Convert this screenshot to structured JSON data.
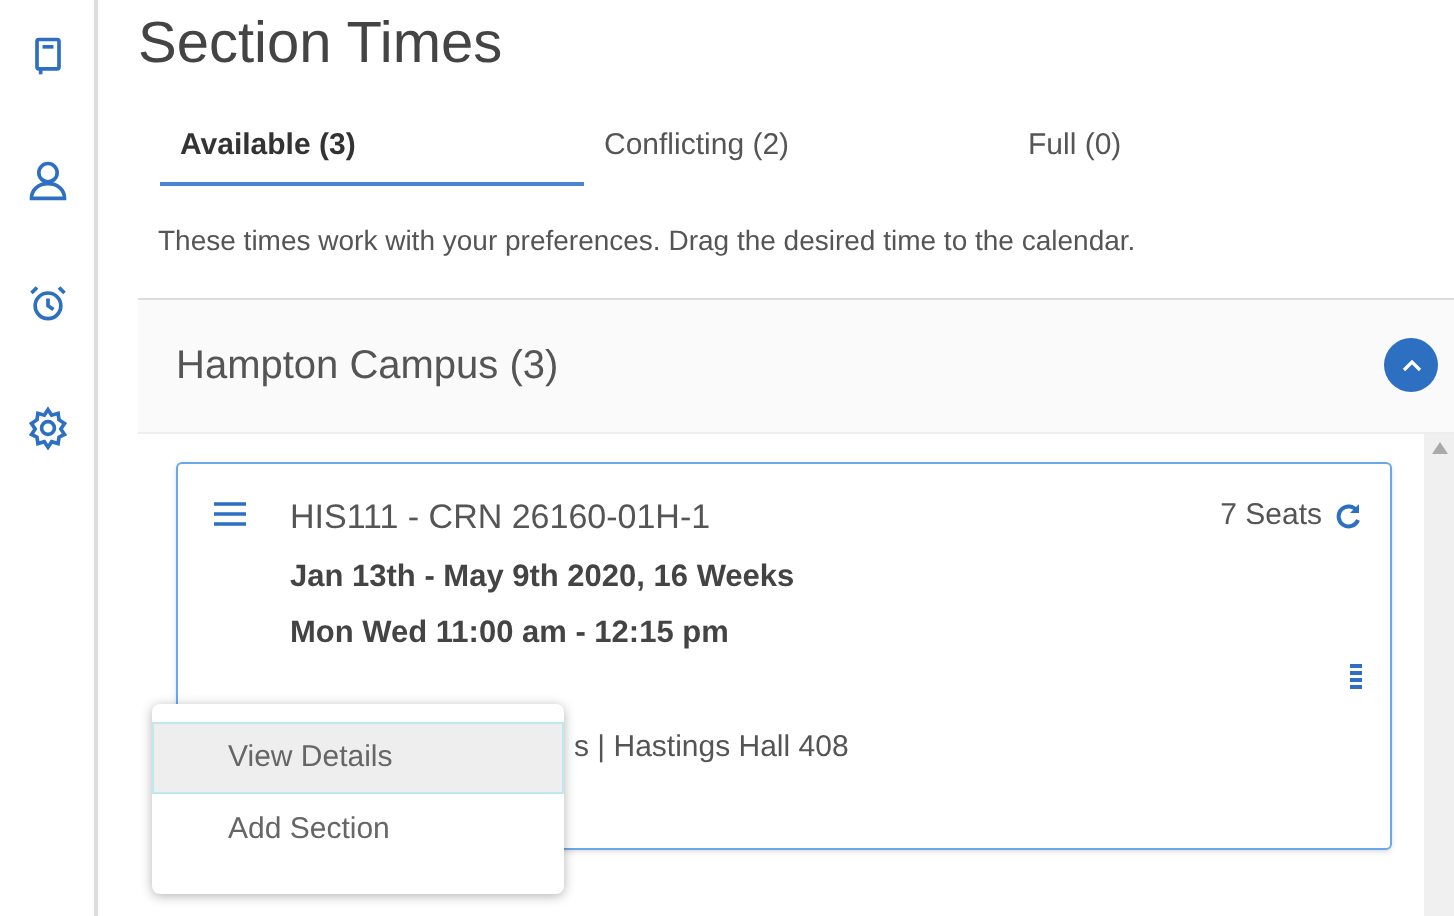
{
  "title": "Section Times",
  "tabs": [
    {
      "label": "Available (3)",
      "selected": true
    },
    {
      "label": "Conflicting (2)",
      "selected": false
    },
    {
      "label": "Full (0)",
      "selected": false
    }
  ],
  "description": "These times work with your preferences. Drag the desired time to the calendar.",
  "group": {
    "title": "Hampton Campus (3)",
    "expanded": true
  },
  "section": {
    "course": "HIS111 - CRN 26160-01H-1",
    "seats": "7 Seats",
    "dates": "Jan 13th - May 9th 2020, 16 Weeks",
    "schedule": "Mon Wed 11:00 am - 12:15 pm",
    "location": "s | Hastings Hall 408"
  },
  "menu": [
    {
      "label": "View Details",
      "selected": true
    },
    {
      "label": "Add Section",
      "selected": false
    }
  ]
}
